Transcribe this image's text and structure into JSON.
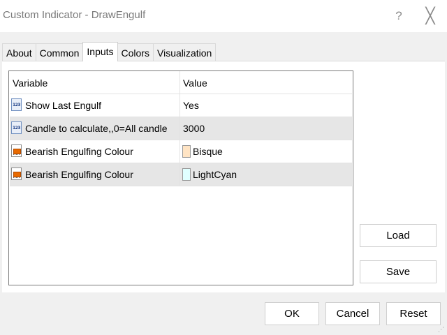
{
  "window": {
    "title": "Custom Indicator - DrawEngulf",
    "help_label": "?",
    "close_label": "╳"
  },
  "tabs": [
    {
      "label": "About"
    },
    {
      "label": "Common"
    },
    {
      "label": "Inputs",
      "active": true
    },
    {
      "label": "Colors"
    },
    {
      "label": "Visualization"
    }
  ],
  "table": {
    "headers": {
      "variable": "Variable",
      "value": "Value"
    },
    "rows": [
      {
        "icon": "number-parameter-icon",
        "variable": "Show Last Engulf",
        "value": "Yes"
      },
      {
        "icon": "number-parameter-icon",
        "variable": "Candle to calculate,,0=All candle",
        "value": "3000"
      },
      {
        "icon": "color-parameter-icon",
        "variable": "Bearish Engulfing Colour",
        "value": "Bisque",
        "color": "#ffe4c4"
      },
      {
        "icon": "color-parameter-icon",
        "variable": "Bearish Engulfing Colour",
        "value": "LightCyan",
        "color": "#e0ffff"
      }
    ],
    "icon_text": "123"
  },
  "buttons": {
    "load": "Load",
    "save": "Save",
    "ok": "OK",
    "cancel": "Cancel",
    "reset": "Reset"
  }
}
